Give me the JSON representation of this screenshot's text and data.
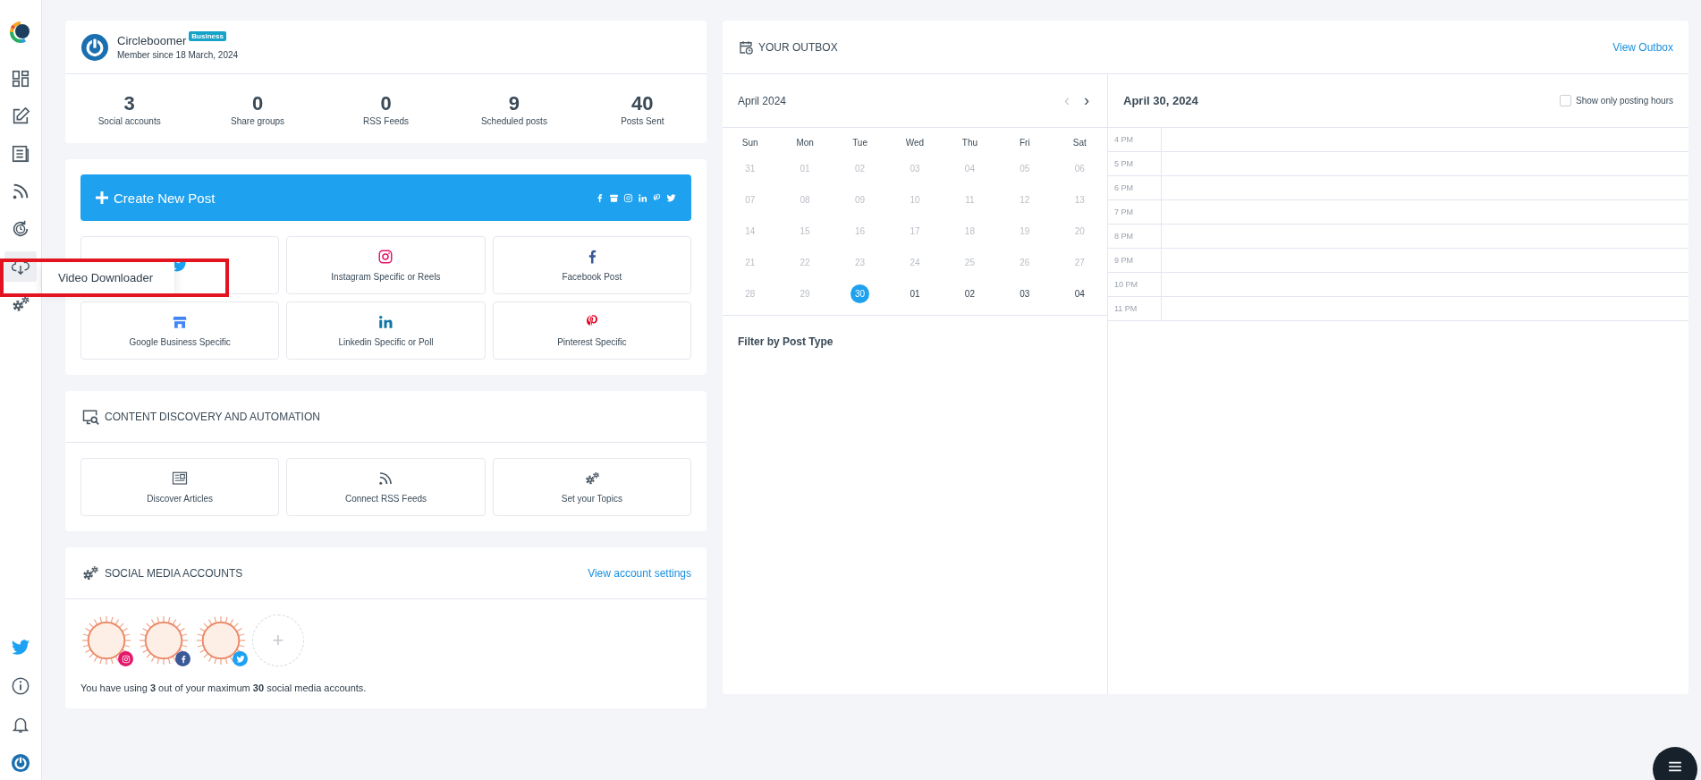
{
  "sidebar": {
    "items": [
      {
        "selected": false
      },
      {
        "selected": false
      },
      {
        "selected": false
      },
      {
        "selected": false
      },
      {
        "selected": false
      },
      {
        "selected": true
      },
      {
        "selected": false
      }
    ],
    "bottom_items": [
      {
        "kind": "twitter"
      },
      {
        "kind": "info"
      },
      {
        "kind": "bell"
      },
      {
        "kind": "power"
      }
    ]
  },
  "tooltip": {
    "text": "Video Downloader"
  },
  "profile": {
    "name": "Circleboomer",
    "badge": "Business",
    "member_since": "Member since 18 March, 2024",
    "stats": [
      {
        "value": "3",
        "label": "Social accounts"
      },
      {
        "value": "0",
        "label": "Share groups"
      },
      {
        "value": "0",
        "label": "RSS Feeds"
      },
      {
        "value": "9",
        "label": "Scheduled posts"
      },
      {
        "value": "40",
        "label": "Posts Sent"
      }
    ]
  },
  "create_post": {
    "label": "Create New Post",
    "post_types": [
      {
        "kind": "twitter"
      },
      {
        "kind": "instagram",
        "label": "Instagram Specific or Reels"
      },
      {
        "kind": "facebook",
        "label": "Facebook Post"
      },
      {
        "kind": "google",
        "label": "Google Business Specific"
      },
      {
        "kind": "linkedin",
        "label": "Linkedin Specific or Poll"
      },
      {
        "kind": "pinterest",
        "label": "Pinterest Specific"
      }
    ]
  },
  "content_discovery": {
    "title": "CONTENT DISCOVERY AND AUTOMATION",
    "items": [
      {
        "kind": "articles",
        "label": "Discover Articles"
      },
      {
        "kind": "rss",
        "label": "Connect RSS Feeds"
      },
      {
        "kind": "topics",
        "label": "Set your Topics"
      }
    ]
  },
  "social_accounts": {
    "title": "SOCIAL MEDIA ACCOUNTS",
    "link": "View account settings",
    "accounts": [
      {
        "kind": "instagram",
        "color": "#e4186b"
      },
      {
        "kind": "facebook",
        "color": "#3b5998"
      },
      {
        "kind": "twitter",
        "color": "#1da1f2"
      }
    ],
    "add": "+",
    "note": "You have using **3** out of your maximum **30** social media accounts."
  },
  "outbox": {
    "title": "YOUR OUTBOX",
    "link": "View Outbox",
    "calendar": {
      "month": "April 2024",
      "prev": "‹",
      "next": "›",
      "weekdays": [
        "Sun",
        "Mon",
        "Tue",
        "Wed",
        "Thu",
        "Fri",
        "Sat"
      ],
      "weeks": [
        [
          {
            "label": "31",
            "muted": true,
            "selected": false
          },
          {
            "label": "01",
            "muted": true,
            "selected": false
          },
          {
            "label": "02",
            "muted": true,
            "selected": false
          },
          {
            "label": "03",
            "muted": true,
            "selected": false
          },
          {
            "label": "04",
            "muted": true,
            "selected": false
          },
          {
            "label": "05",
            "muted": true,
            "selected": false
          },
          {
            "label": "06",
            "muted": true,
            "selected": false
          }
        ],
        [
          {
            "label": "07",
            "muted": true,
            "selected": false
          },
          {
            "label": "08",
            "muted": true,
            "selected": false
          },
          {
            "label": "09",
            "muted": true,
            "selected": false
          },
          {
            "label": "10",
            "muted": true,
            "selected": false
          },
          {
            "label": "11",
            "muted": true,
            "selected": false
          },
          {
            "label": "12",
            "muted": true,
            "selected": false
          },
          {
            "label": "13",
            "muted": true,
            "selected": false
          }
        ],
        [
          {
            "label": "14",
            "muted": true,
            "selected": false
          },
          {
            "label": "15",
            "muted": true,
            "selected": false
          },
          {
            "label": "16",
            "muted": true,
            "selected": false
          },
          {
            "label": "17",
            "muted": true,
            "selected": false
          },
          {
            "label": "18",
            "muted": true,
            "selected": false
          },
          {
            "label": "19",
            "muted": true,
            "selected": false
          },
          {
            "label": "20",
            "muted": true,
            "selected": false
          }
        ],
        [
          {
            "label": "21",
            "muted": true,
            "selected": false
          },
          {
            "label": "22",
            "muted": true,
            "selected": false
          },
          {
            "label": "23",
            "muted": true,
            "selected": false
          },
          {
            "label": "24",
            "muted": true,
            "selected": false
          },
          {
            "label": "25",
            "muted": true,
            "selected": false
          },
          {
            "label": "26",
            "muted": true,
            "selected": false
          },
          {
            "label": "27",
            "muted": true,
            "selected": false
          }
        ],
        [
          {
            "label": "28",
            "muted": true,
            "selected": false
          },
          {
            "label": "29",
            "muted": true,
            "selected": false
          },
          {
            "label": "30",
            "muted": false,
            "selected": true
          },
          {
            "label": "01",
            "muted": false,
            "selected": false
          },
          {
            "label": "02",
            "muted": false,
            "selected": false
          },
          {
            "label": "03",
            "muted": false,
            "selected": false
          },
          {
            "label": "04",
            "muted": false,
            "selected": false
          }
        ]
      ]
    },
    "filter_title": "Filter by Post Type",
    "day": {
      "date": "April 30, 2024",
      "posting_hours": {
        "label": "Show only posting hours",
        "checked": false
      },
      "hours": [
        "4 PM",
        "5 PM",
        "6 PM",
        "7 PM",
        "8 PM",
        "9 PM",
        "10 PM",
        "11 PM"
      ]
    }
  }
}
